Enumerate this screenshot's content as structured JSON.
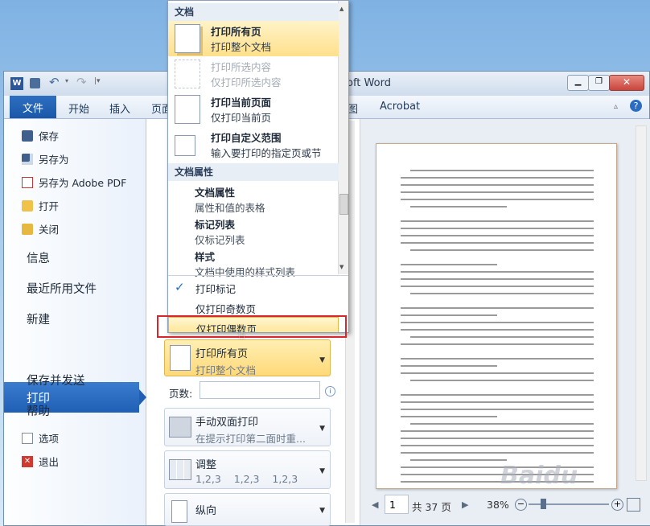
{
  "window": {
    "title_fragment": "oft Word",
    "quick_access": [
      "save-icon",
      "undo-icon",
      "redo-icon"
    ]
  },
  "ribbon": {
    "tabs": [
      "文件",
      "开始",
      "插入",
      "页面",
      "图",
      "Acrobat"
    ]
  },
  "backstage": {
    "small_items": [
      {
        "label": "保存",
        "icon": "save-icon"
      },
      {
        "label": "另存为",
        "icon": "save-as-icon"
      },
      {
        "label": "另存为 Adobe PDF",
        "icon": "pdf-icon"
      },
      {
        "label": "打开",
        "icon": "folder-open-icon"
      },
      {
        "label": "关闭",
        "icon": "folder-close-icon"
      }
    ],
    "big_items": [
      "信息",
      "最近所用文件",
      "新建",
      "打印",
      "保存并发送",
      "帮助"
    ],
    "bottom_items": [
      {
        "label": "选项",
        "icon": "options-icon"
      },
      {
        "label": "退出",
        "icon": "exit-icon"
      }
    ],
    "selected": "打印"
  },
  "print_settings": {
    "range_button": {
      "title": "打印所有页",
      "desc": "打印整个文档"
    },
    "pages_label": "页数:",
    "duplex_button": {
      "title": "手动双面打印",
      "desc": "在提示打印第二面时重..."
    },
    "collate_button": {
      "title": "调整",
      "desc": "1,2,3    1,2,3    1,2,3"
    },
    "orientation_button": {
      "title": "纵向"
    }
  },
  "dropdown": {
    "group1": "文档",
    "items": [
      {
        "title": "打印所有页",
        "desc": "打印整个文档",
        "enabled": true
      },
      {
        "title": "打印所选内容",
        "desc": "仅打印所选内容",
        "enabled": false
      },
      {
        "title": "打印当前页面",
        "desc": "仅打印当前页",
        "enabled": true
      },
      {
        "title": "打印自定义范围",
        "desc": "输入要打印的指定页或节",
        "enabled": true
      }
    ],
    "group2": "文档属性",
    "sub_items": [
      {
        "title": "文档属性",
        "desc": "属性和值的表格"
      },
      {
        "title": "标记列表",
        "desc": "仅标记列表"
      },
      {
        "title": "样式",
        "desc": "文档中使用的样式列表"
      }
    ],
    "options": [
      {
        "label": "打印标记",
        "checked": true
      },
      {
        "label": "仅打印奇数页",
        "checked": false
      },
      {
        "label": "仅打印偶数页",
        "checked": false,
        "highlighted": true
      }
    ]
  },
  "preview": {
    "page_number": "1",
    "page_total": "共 37 页",
    "zoom": "38%"
  },
  "watermark": "Baidu"
}
